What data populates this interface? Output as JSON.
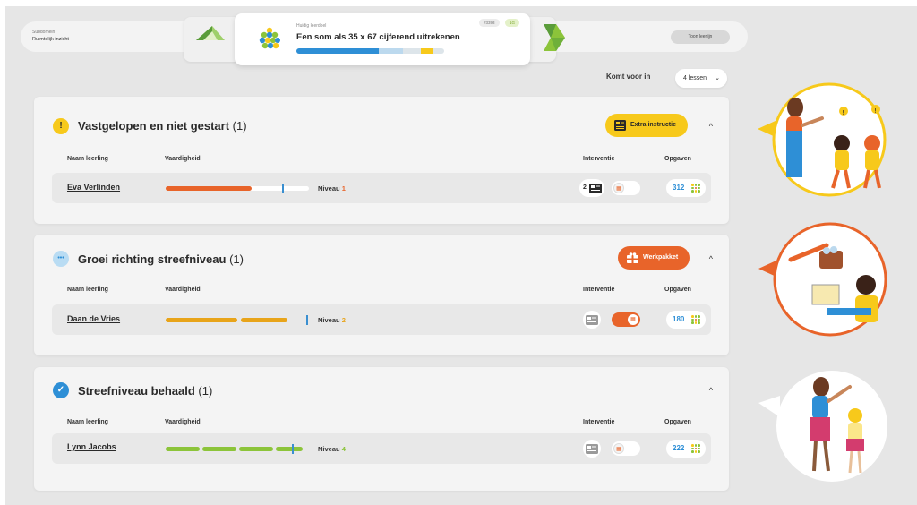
{
  "header": {
    "subdomain_label": "Subdomein",
    "subdomain_value": "Ruimtelijk inzicht",
    "show_button": "Toon leerlijn",
    "exercise_label": "Huidig leerdoel",
    "exercise_title": "Een som als 35 x 67 cijferend uitrekenen",
    "badge_1": "#3393",
    "badge_2": "1G",
    "progress": {
      "done": 0.56,
      "mid": 0.16,
      "warn": 0.08
    }
  },
  "filter": {
    "label": "Komt voor in",
    "value": "4 lessen",
    "chevron": "⌄"
  },
  "columns": {
    "name": "Naam leerling",
    "skill": "Vaardigheid",
    "intervention": "Interventie",
    "exercises": "Opgaven"
  },
  "sections": [
    {
      "title": "Vastgelopen en niet gestart",
      "count": "(1)",
      "icon": "exclamation-icon",
      "icon_glyph": "!",
      "action_label": "Extra instructie",
      "action_color": "#f7c91b",
      "collapse": "^",
      "student": {
        "name": "Eva Verlinden",
        "level_label": "Niveau",
        "level": "1",
        "level_color": "#e8642a",
        "skill_fill": 0.6,
        "skill_marker": 0.81,
        "bar_color": "#e8642a",
        "intervention_count": "2",
        "toggle_on": false,
        "exercises": "312"
      }
    },
    {
      "title": "Groei richting streefniveau",
      "count": "(1)",
      "icon": "dots-icon",
      "icon_glyph": "•••",
      "action_label": "Werkpakket",
      "action_color": "#e8642a",
      "collapse": "^",
      "student": {
        "name": "Daan de Vries",
        "level_label": "Niveau",
        "level": "2",
        "level_color": "#e8a41a",
        "skill_fill": 0.86,
        "skill_marker": 0.98,
        "bar_color": "#e8a41a",
        "intervention_count": "",
        "toggle_on": true,
        "exercises": "180"
      }
    },
    {
      "title": "Streefniveau behaald",
      "count": "(1)",
      "icon": "check-icon",
      "icon_glyph": "✓",
      "action_label": "",
      "action_color": "",
      "collapse": "^",
      "student": {
        "name": "Lynn Jacobs",
        "level_label": "Niveau",
        "level": "4",
        "level_color": "#8cc43a",
        "skill_fill": 0.95,
        "skill_marker": 0.92,
        "bar_color": "#8cc43a",
        "intervention_count": "",
        "toggle_on": false,
        "exercises": "222"
      }
    }
  ],
  "colors": {
    "blue": "#3a9ad9",
    "orange": "#e8642a",
    "yellow": "#f7c91b",
    "green": "#8cc43a"
  }
}
